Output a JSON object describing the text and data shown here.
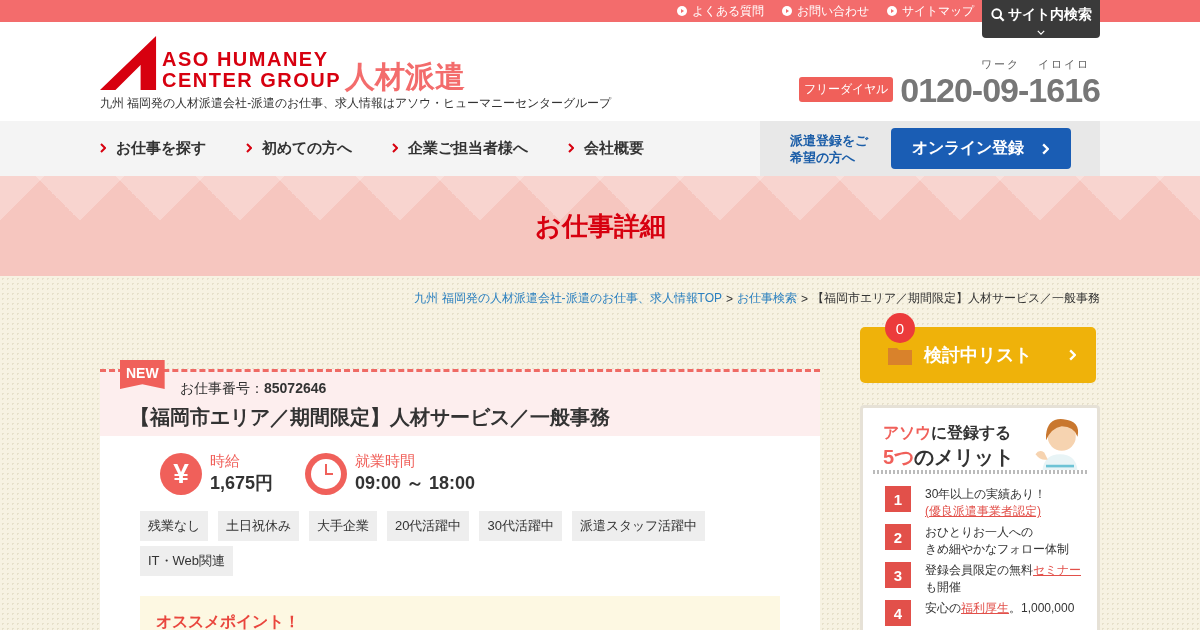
{
  "top_links": [
    "よくある質問",
    "お問い合わせ",
    "サイトマップ"
  ],
  "site_search": {
    "label": "サイト内検索"
  },
  "logo": {
    "line1": "ASO HUMANEY",
    "line2": "CENTER GROUP",
    "tagline": "人材派遣",
    "description": "九州 福岡発の人材派遣会社-派遣のお仕事、求人情報はアソウ・ヒューマニーセンターグループ"
  },
  "phone": {
    "badge": "フリーダイヤル",
    "parts": [
      {
        "text": "0120-"
      },
      {
        "text": "09",
        "ruby": "ワーク"
      },
      {
        "text": "-"
      },
      {
        "text": "1616",
        "ruby": "イロイロ"
      }
    ]
  },
  "nav": [
    "お仕事を探す",
    "初めての方へ",
    "企業ご担当者様へ",
    "会社概要"
  ],
  "register": {
    "note": "派遣登録をご希望の方へ",
    "button": "オンライン登録"
  },
  "page_title": "お仕事詳細",
  "breadcrumb_separator": ">",
  "breadcrumb": [
    {
      "text": "九州 福岡発の人材派遣会社-派遣のお仕事、求人情報TOP",
      "link": true
    },
    {
      "text": "お仕事検索",
      "link": true
    },
    {
      "text": "【福岡市エリア／期間限定】人材サービス／一般事務",
      "link": false
    }
  ],
  "job": {
    "new_label": "NEW",
    "number_label": "お仕事番号：",
    "number": "85072646",
    "title": "【福岡市エリア／期間限定】人材サービス／一般事務",
    "facts": [
      {
        "kind": "yen",
        "icon": "¥",
        "label": "時給",
        "value": "1,675円"
      },
      {
        "kind": "clock",
        "label": "就業時間",
        "value": "09:00 ～ 18:00"
      }
    ],
    "tags": [
      "残業なし",
      "土日祝休み",
      "大手企業",
      "20代活躍中",
      "30代活躍中",
      "派遣スタッフ活躍中",
      "IT・Web関連"
    ],
    "recommend_title": "オススメポイント！"
  },
  "watchlist": {
    "count": "0",
    "label": "検討中リスト"
  },
  "merits": {
    "heading": [
      [
        {
          "text": "アソウ",
          "accent": true
        },
        {
          "text": "に登録する",
          "accent": false
        }
      ],
      [
        {
          "text": "5つ",
          "accent": true
        },
        {
          "text": "のメリット",
          "accent": false
        }
      ]
    ],
    "items": [
      {
        "number": "1",
        "segments": [
          {
            "kind": "text",
            "text": "30年以上の実績あり！"
          },
          {
            "kind": "link",
            "text": "(優良派遣事業者認定)"
          }
        ]
      },
      {
        "number": "2",
        "segments": [
          {
            "kind": "line",
            "text": "おひとりお一人への"
          },
          {
            "kind": "line",
            "text": "きめ細やかなフォロー体制"
          }
        ]
      },
      {
        "number": "3",
        "segments": [
          {
            "kind": "text",
            "text": "登録会員限定の無料"
          },
          {
            "kind": "link",
            "text": "セミナー"
          },
          {
            "kind": "text",
            "text": "も開催"
          }
        ]
      },
      {
        "number": "4",
        "segments": [
          {
            "kind": "text",
            "text": "安心の"
          },
          {
            "kind": "link",
            "text": "福利厚生"
          },
          {
            "kind": "text",
            "text": "。1,000,000"
          }
        ]
      }
    ]
  }
}
